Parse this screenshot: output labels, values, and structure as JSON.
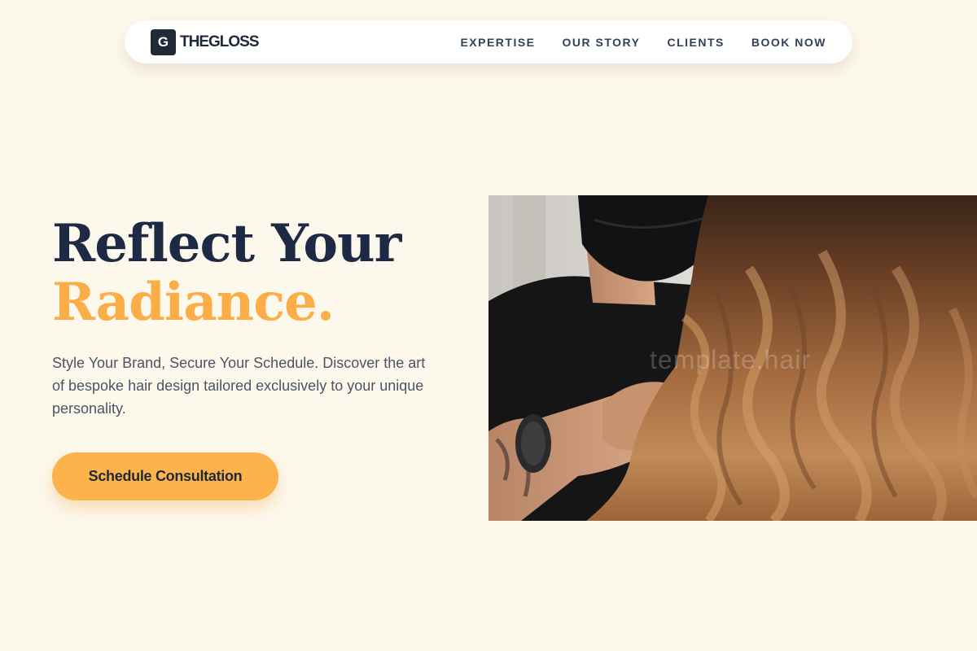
{
  "nav": {
    "logo_mark": "G",
    "logo_text": "THEGLOSS",
    "links": [
      {
        "label": "EXPERTISE"
      },
      {
        "label": "OUR STORY"
      },
      {
        "label": "CLIENTS"
      },
      {
        "label": "BOOK NOW"
      }
    ]
  },
  "hero": {
    "title_line1": "Reflect Your",
    "title_line2": "Radiance.",
    "subtitle": "Style Your Brand, Secure Your Schedule. Discover the art of bespoke hair design tailored exclusively to your unique personality.",
    "cta_label": "Schedule Consultation"
  },
  "photo": {
    "watermark": "template.hair"
  },
  "colors": {
    "background": "#fdf8ec",
    "accent": "#fbad47",
    "heading": "#1e2a44"
  }
}
